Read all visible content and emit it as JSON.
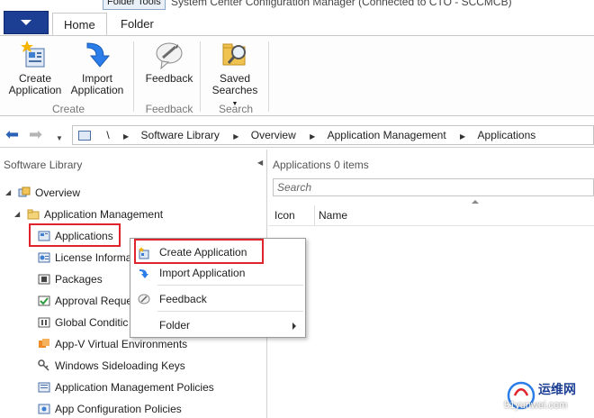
{
  "window": {
    "context_tab": "Folder Tools",
    "title": "System Center Configuration Manager (Connected to CTO - SCCMCB)"
  },
  "tabs": [
    {
      "label": "Home",
      "active": true
    },
    {
      "label": "Folder",
      "active": false
    }
  ],
  "ribbon": {
    "create_application": "Create Application",
    "import_application": "Import Application",
    "feedback": "Feedback",
    "saved_searches": "Saved Searches",
    "group_create": "Create",
    "group_feedback": "Feedback",
    "group_search": "Search"
  },
  "address": {
    "root": "\\",
    "crumbs": [
      "Software Library",
      "Overview",
      "Application Management",
      "Applications"
    ]
  },
  "nav": {
    "title": "Software Library",
    "items": [
      {
        "label": "Overview",
        "icon": "overview-icon"
      },
      {
        "label": "Application Management",
        "icon": "folder-icon"
      },
      {
        "label": "Applications",
        "icon": "applications-icon"
      },
      {
        "label": "License Informa",
        "icon": "license-icon"
      },
      {
        "label": "Packages",
        "icon": "package-icon"
      },
      {
        "label": "Approval Reque",
        "icon": "approval-icon"
      },
      {
        "label": "Global Conditic",
        "icon": "global-conditions-icon"
      },
      {
        "label": "App-V Virtual Environments",
        "icon": "appv-icon"
      },
      {
        "label": "Windows Sideloading Keys",
        "icon": "key-icon"
      },
      {
        "label": "Application Management Policies",
        "icon": "policy-icon"
      },
      {
        "label": "App Configuration Policies",
        "icon": "config-policy-icon"
      }
    ]
  },
  "content": {
    "title": "Applications",
    "count": "0 items",
    "search_placeholder": "Search",
    "columns": [
      "Icon",
      "Name"
    ]
  },
  "context_menu": {
    "items": [
      "Create Application",
      "Import Application",
      "Feedback",
      "Folder"
    ]
  },
  "watermark": {
    "text_top": "运维网",
    "text_bottom": "51yunwei.com"
  },
  "colors": {
    "accent_blue": "#1c3f94",
    "highlight_red": "#e0242c"
  }
}
